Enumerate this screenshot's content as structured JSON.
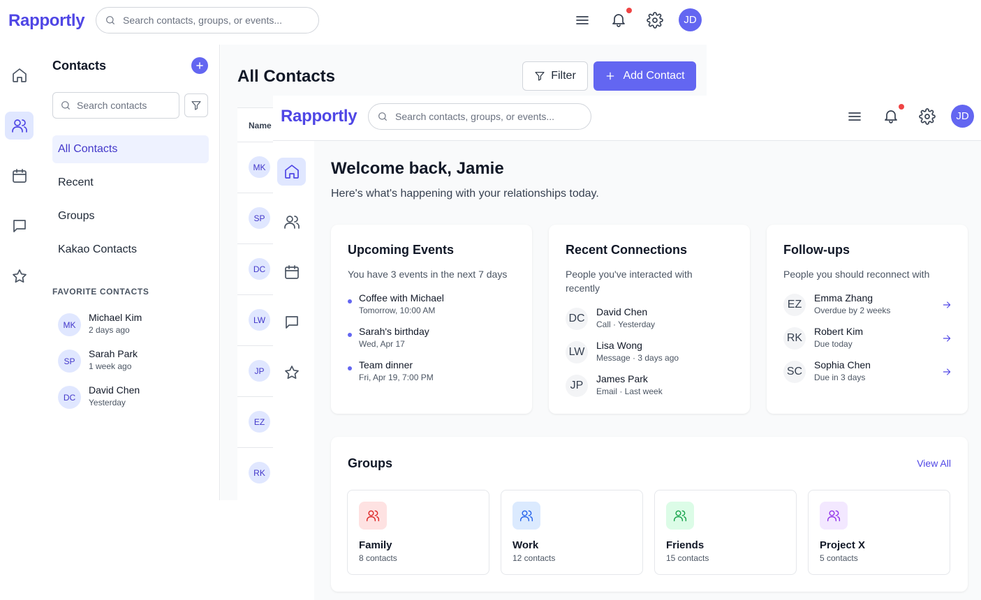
{
  "app": {
    "name": "Rapportly"
  },
  "topbar": {
    "search_placeholder": "Search contacts, groups, or events...",
    "user_initials": "JD"
  },
  "colors": {
    "accent": "#6366f1",
    "accent_dark": "#4f46e5",
    "notification": "#ef4444"
  },
  "rail": {
    "icons": [
      "home-icon",
      "users-icon",
      "calendar-icon",
      "message-icon",
      "star-icon"
    ]
  },
  "contacts_panel": {
    "title": "Contacts",
    "search_placeholder": "Search contacts",
    "nav": [
      {
        "label": "All Contacts",
        "active": true
      },
      {
        "label": "Recent"
      },
      {
        "label": "Groups"
      },
      {
        "label": "Kakao Contacts"
      }
    ],
    "favorites_heading": "FAVORITE CONTACTS",
    "favorites": [
      {
        "initials": "MK",
        "name": "Michael Kim",
        "sub": "2 days ago"
      },
      {
        "initials": "SP",
        "name": "Sarah Park",
        "sub": "1 week ago"
      },
      {
        "initials": "DC",
        "name": "David Chen",
        "sub": "Yesterday"
      }
    ]
  },
  "contacts_main": {
    "title": "All Contacts",
    "filter_label": "Filter",
    "add_label": "Add Contact",
    "column_name": "Name",
    "rows": [
      "MK",
      "SP",
      "DC",
      "LW",
      "JP",
      "EZ",
      "RK"
    ]
  },
  "dashboard": {
    "welcome": "Welcome back, Jamie",
    "subtitle": "Here's what's happening with your relationships today.",
    "upcoming": {
      "title": "Upcoming Events",
      "subtitle": "You have 3 events in the next 7 days",
      "items": [
        {
          "title": "Coffee with Michael",
          "sub": "Tomorrow, 10:00 AM"
        },
        {
          "title": "Sarah's birthday",
          "sub": "Wed, Apr 17"
        },
        {
          "title": "Team dinner",
          "sub": "Fri, Apr 19, 7:00 PM"
        }
      ]
    },
    "recent": {
      "title": "Recent Connections",
      "subtitle": "People you've interacted with recently",
      "items": [
        {
          "initials": "DC",
          "name": "David Chen",
          "sub": "Call · Yesterday"
        },
        {
          "initials": "LW",
          "name": "Lisa Wong",
          "sub": "Message · 3 days ago"
        },
        {
          "initials": "JP",
          "name": "James Park",
          "sub": "Email · Last week"
        }
      ]
    },
    "followups": {
      "title": "Follow-ups",
      "subtitle": "People you should reconnect with",
      "items": [
        {
          "initials": "EZ",
          "name": "Emma Zhang",
          "sub": "Overdue by 2 weeks"
        },
        {
          "initials": "RK",
          "name": "Robert Kim",
          "sub": "Due today"
        },
        {
          "initials": "SC",
          "name": "Sophia Chen",
          "sub": "Due in 3 days"
        }
      ]
    },
    "groups": {
      "title": "Groups",
      "view_all": "View All",
      "items": [
        {
          "name": "Family",
          "count": "8 contacts",
          "bg": "#fee2e2",
          "fg": "#dc2626"
        },
        {
          "name": "Work",
          "count": "12 contacts",
          "bg": "#dbeafe",
          "fg": "#2563eb"
        },
        {
          "name": "Friends",
          "count": "15 contacts",
          "bg": "#dcfce7",
          "fg": "#16a34a"
        },
        {
          "name": "Project X",
          "count": "5 contacts",
          "bg": "#f3e8ff",
          "fg": "#9333ea"
        }
      ]
    }
  }
}
